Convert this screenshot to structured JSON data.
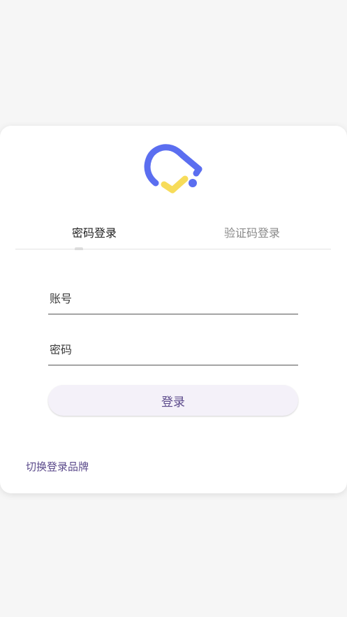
{
  "tabs": [
    {
      "label": "密码登录",
      "active": true
    },
    {
      "label": "验证码登录",
      "active": false
    }
  ],
  "form": {
    "account_placeholder": "账号",
    "account_value": "",
    "password_placeholder": "密码",
    "password_value": "",
    "login_label": "登录"
  },
  "footer": {
    "switch_brand_label": "切换登录品牌"
  },
  "colors": {
    "logo_blue": "#5b6ef0",
    "logo_yellow": "#f7dc5a",
    "accent_purple": "#5b4a8b",
    "button_bg": "#f4f1f9"
  },
  "icons": {
    "logo": "bell-check-logo"
  }
}
